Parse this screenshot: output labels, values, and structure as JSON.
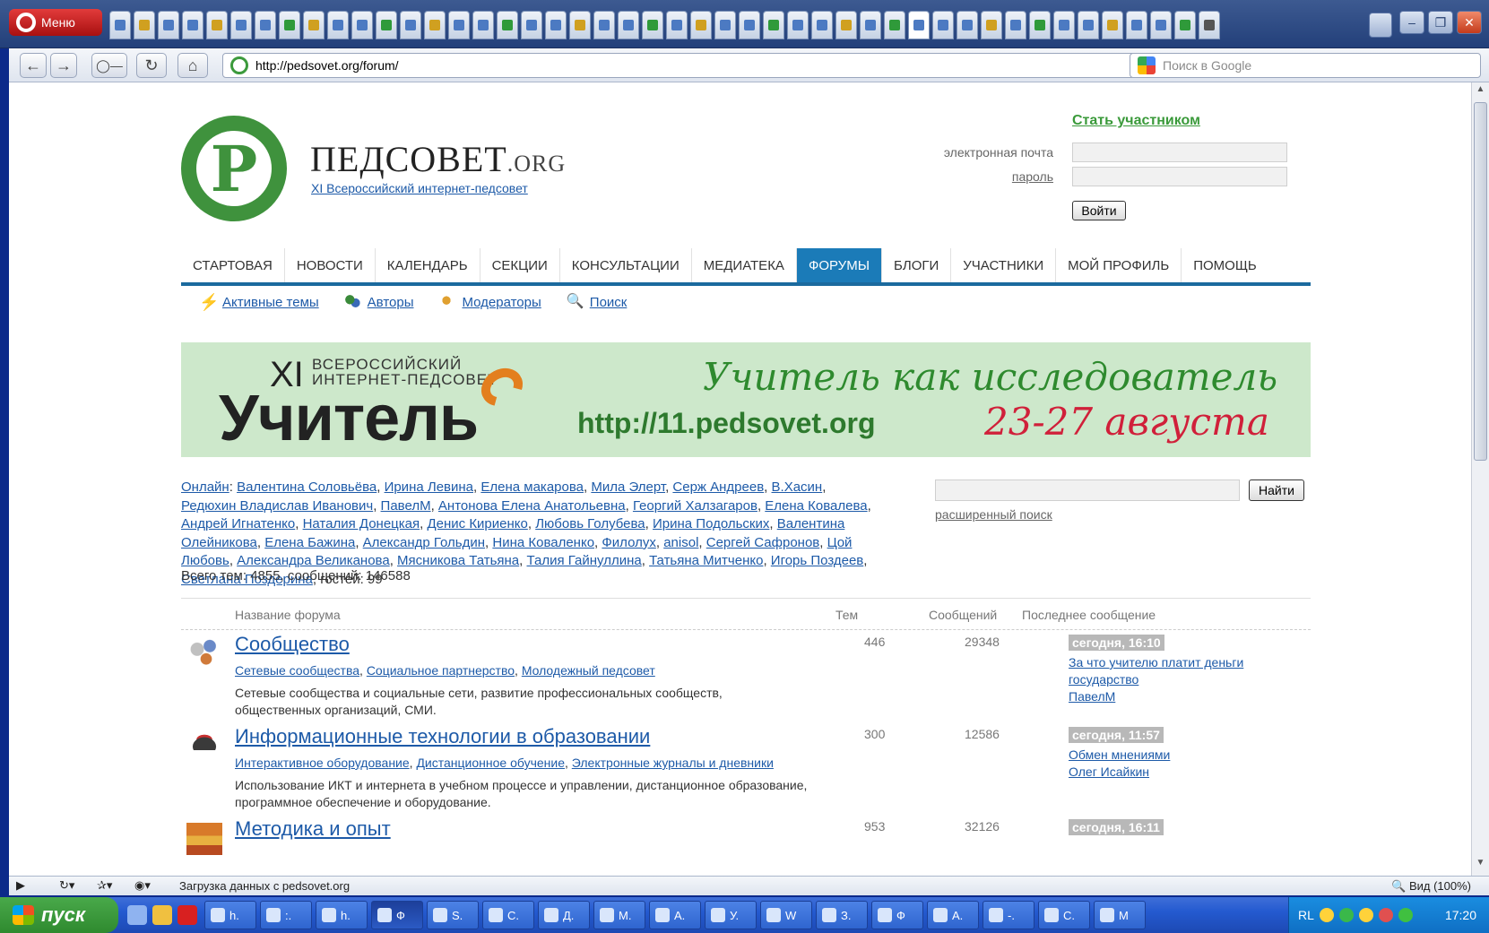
{
  "browser": {
    "menu_label": "Меню",
    "url": "http://pedsovet.org/forum/",
    "search_placeholder": "Поиск в Google",
    "status_text": "Загрузка данных с pedsovet.org",
    "zoom_label": "Вид (100%)"
  },
  "site": {
    "title": "ПЕДСОВЕТ",
    "title_suffix": ".ORG",
    "subtitle": "XI Всероссийский интернет-педсовет",
    "join_link": "Стать участником",
    "email_label": "электронная почта",
    "password_label": "пароль",
    "login_button": "Войти",
    "brand_color": "#3f923d",
    "accent_color": "#1b7bb8"
  },
  "nav": {
    "items": [
      "СТАРТОВАЯ",
      "НОВОСТИ",
      "КАЛЕНДАРЬ",
      "СЕКЦИИ",
      "КОНСУЛЬТАЦИИ",
      "МЕДИАТЕКА",
      "ФОРУМЫ",
      "БЛОГИ",
      "УЧАСТНИКИ",
      "МОЙ ПРОФИЛЬ",
      "ПОМОЩЬ"
    ],
    "active": "ФОРУМЫ"
  },
  "subnav": {
    "active_topics": "Активные темы",
    "authors": "Авторы",
    "moderators": "Модераторы",
    "search": "Поиск"
  },
  "banner": {
    "numeral": "XI",
    "line1": "ВСЕРОССИЙСКИЙ",
    "line2": "ИНТЕРНЕТ-ПЕДСОВЕТ",
    "word": "Учитель",
    "slogan": "Учитель как исследователь",
    "url": "http://11.pedsovet.org",
    "dates": "23-27 августа"
  },
  "online": {
    "label": "Онлайн",
    "users": [
      "Валентина Соловьёва",
      "Ирина Левина",
      "Елена макарова",
      "Мила Элерт",
      "Серж Андреев",
      "В.Хасин",
      "Редюхин Владислав Иванович",
      "ПавелМ",
      "Антонова Елена Анатольевна",
      "Георгий Халзагаров",
      "Елена Ковалева",
      "Андрей Игнатенко",
      "Наталия Донецкая",
      "Денис Кириенко",
      "Любовь Голубева",
      "Ирина Подольских",
      "Валентина Олейникова",
      "Елена Бажина",
      "Александр Гольдин",
      "Нина Коваленко",
      "Филолух",
      "anisol",
      "Сергей Сафронов",
      "Цой Любовь",
      "Александра Великанова",
      "Мясникова Татьяна",
      "Талия Гайнуллина",
      "Татьяна Митченко",
      "Игорь Поздеев",
      "Светлана Поздерина"
    ],
    "guests_text": ", гостей: 99",
    "totals": "Всего тем: 4855, сообщений: 146588"
  },
  "forum_search": {
    "button": "Найти",
    "advanced": "расширенный поиск"
  },
  "table": {
    "headers": {
      "name": "Название форума",
      "topics": "Тем",
      "messages": "Сообщений",
      "last": "Последнее сообщение"
    },
    "rows": [
      {
        "title": "Сообщество",
        "subs": [
          "Сетевые сообщества",
          "Социальное партнерство",
          "Молодежный педсовет"
        ],
        "desc": "Сетевые сообщества и социальные сети, развитие профессиональных сообществ, общественных организаций, СМИ.",
        "topics": "446",
        "messages": "29348",
        "last_date": "сегодня, 16:10",
        "last_topic": "За что учителю платит деньги государство",
        "last_author": "ПавелМ"
      },
      {
        "title": "Информационные технологии в образовании",
        "subs": [
          "Интерактивное оборудование",
          "Дистанционное обучение",
          "Электронные журналы и дневники"
        ],
        "desc": "Использование ИКТ и интернета в учебном процессе и управлении, дистанционное образование, программное обеспечение и оборудование.",
        "topics": "300",
        "messages": "12586",
        "last_date": "сегодня, 11:57",
        "last_topic": "Обмен мнениями",
        "last_author": "Олег Исайкин"
      },
      {
        "title": "Методика и опыт",
        "subs": [],
        "desc": "",
        "topics": "953",
        "messages": "32126",
        "last_date": "сегодня, 16:11",
        "last_topic": "",
        "last_author": ""
      }
    ]
  },
  "taskbar": {
    "start": "пуск",
    "tasks": [
      "h.",
      ":.",
      "h.",
      "Ф",
      "S.",
      "С.",
      "Д.",
      "М.",
      "А.",
      "У.",
      "W",
      "З.",
      "Ф",
      "А.",
      "-.",
      "С.",
      "М"
    ],
    "lang": "RL",
    "clock": "17:20"
  }
}
